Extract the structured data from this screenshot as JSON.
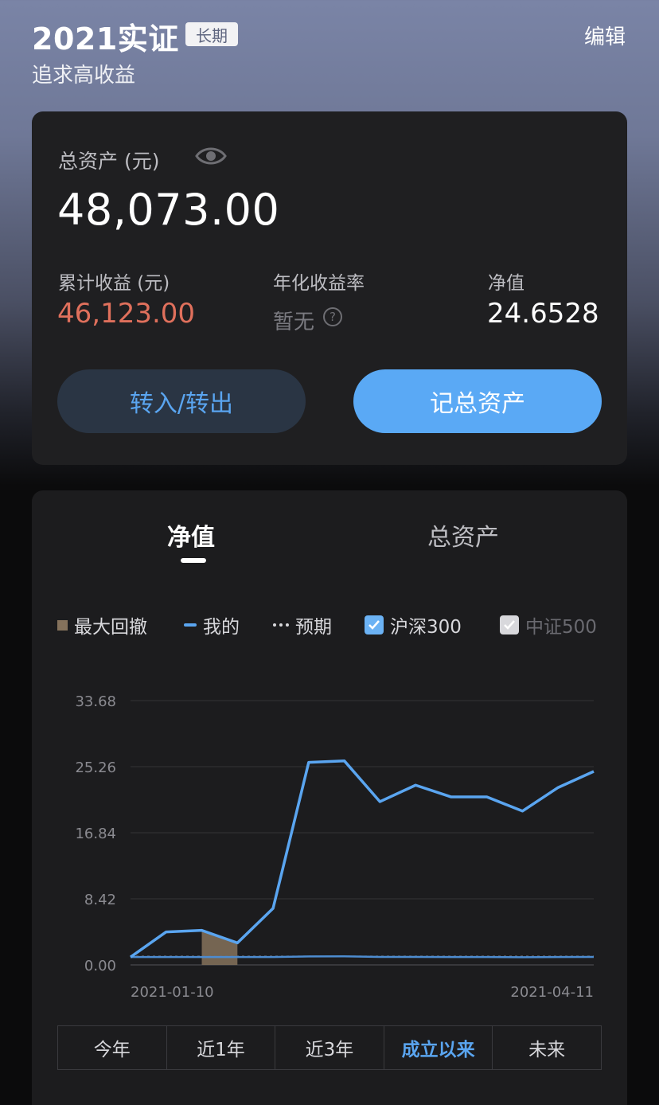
{
  "header": {
    "title": "2021实证",
    "tag": "长期",
    "subtitle": "追求高收益",
    "edit_label": "编辑"
  },
  "summary": {
    "total_assets_label": "总资产 (元)",
    "total_assets_value": "48,073.00",
    "cumulative_label": "累计收益 (元)",
    "cumulative_value": "46,123.00",
    "annualized_label": "年化收益率",
    "annualized_value": "暂无",
    "nav_label": "净值",
    "nav_value": "24.6528",
    "transfer_button": "转入/转出",
    "record_button": "记总资产"
  },
  "tabs": [
    {
      "label": "净值",
      "active": true
    },
    {
      "label": "总资产",
      "active": false
    }
  ],
  "legend": {
    "max_drawdown": "最大回撤",
    "mine": "我的",
    "expected": "预期",
    "hs300": "沪深300",
    "zz500": "中证500",
    "hs300_checked": true,
    "zz500_checked": false
  },
  "ranges": [
    {
      "label": "今年",
      "active": false
    },
    {
      "label": "近1年",
      "active": false
    },
    {
      "label": "近3年",
      "active": false
    },
    {
      "label": "成立以来",
      "active": true
    },
    {
      "label": "未来",
      "active": false
    }
  ],
  "colors": {
    "accent": "#5aa5f0",
    "loss": "#e0705c",
    "drawdown": "#85725c"
  },
  "chart_data": {
    "type": "line",
    "ylim": [
      0,
      33.68
    ],
    "yticks": [
      "0.00",
      "8.42",
      "16.84",
      "25.26",
      "33.68"
    ],
    "x_start_label": "2021-01-10",
    "x_end_label": "2021-04-11",
    "series": [
      {
        "name": "我的",
        "color": "#5aa5f0",
        "values": [
          1.0,
          4.2,
          4.4,
          2.8,
          7.2,
          25.8,
          26.0,
          20.8,
          22.9,
          21.4,
          21.4,
          19.6,
          22.6,
          24.65
        ]
      },
      {
        "name": "沪深300",
        "color": "#4d8cd0",
        "values": [
          1.0,
          1.0,
          1.0,
          1.0,
          1.0,
          1.08,
          1.09,
          1.02,
          1.02,
          1.0,
          1.0,
          0.98,
          1.0,
          1.02
        ]
      }
    ],
    "expected_value": 1.1,
    "drawdown_range": [
      2,
      3
    ]
  }
}
